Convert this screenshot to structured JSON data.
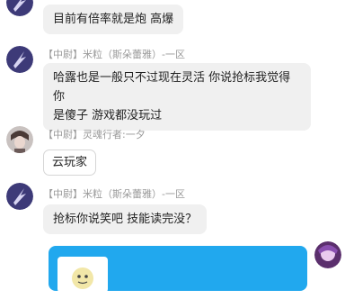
{
  "messages": [
    {
      "id": "m1",
      "text": "目前有倍率就是炮  高爆"
    },
    {
      "id": "m2",
      "rank": "【中尉】",
      "sender": "米粒（斯朵蕾雅）-一区",
      "lines": [
        "哈露也是一般只不过现在灵活 你说抢标我觉得你",
        "是傻子  游戏都没玩过"
      ]
    },
    {
      "id": "m3",
      "rank": "【中尉】",
      "sender": "灵魂行者:一夕",
      "text": "云玩家"
    },
    {
      "id": "m4",
      "rank": "【中尉】",
      "sender": "米粒（斯朵蕾雅）-一区",
      "text": "抢标你说笑吧 技能读完没？"
    },
    {
      "id": "m5",
      "from_self": true,
      "content": "sticker"
    }
  ],
  "colors": {
    "self_bubble": "#21a8ee",
    "other_bubble": "#f0f0f0",
    "meta_text": "#999999"
  }
}
